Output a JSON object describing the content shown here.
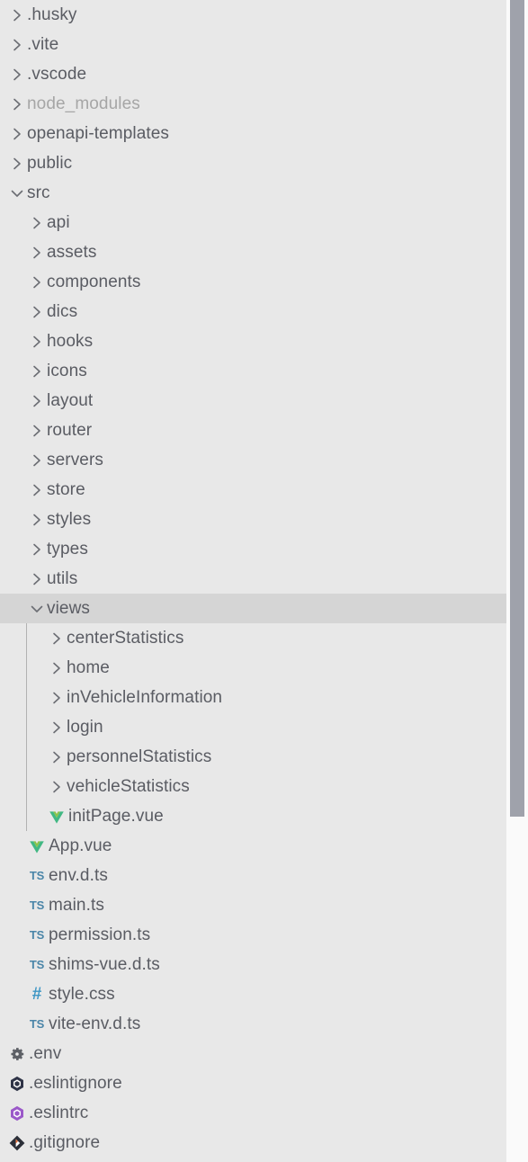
{
  "explorer": {
    "background_color": "#e8e8e8",
    "selected_row_color": "#d5d5d5",
    "label_color": "#5a5c63",
    "dim_label_color": "#a6a6a6",
    "guide_color": "#b2b2b2",
    "scrollbar": {
      "thumb_color": "#9fa2ab",
      "track_color": "#fafafa"
    },
    "rows": [
      {
        "label": ".husky",
        "depth": 0,
        "kind": "folder",
        "state": "collapsed",
        "icon": "chevron-right-icon",
        "dim": false,
        "selected": false
      },
      {
        "label": ".vite",
        "depth": 0,
        "kind": "folder",
        "state": "collapsed",
        "icon": "chevron-right-icon",
        "dim": false,
        "selected": false
      },
      {
        "label": ".vscode",
        "depth": 0,
        "kind": "folder",
        "state": "collapsed",
        "icon": "chevron-right-icon",
        "dim": false,
        "selected": false
      },
      {
        "label": "node_modules",
        "depth": 0,
        "kind": "folder",
        "state": "collapsed",
        "icon": "chevron-right-icon",
        "dim": true,
        "selected": false
      },
      {
        "label": "openapi-templates",
        "depth": 0,
        "kind": "folder",
        "state": "collapsed",
        "icon": "chevron-right-icon",
        "dim": false,
        "selected": false
      },
      {
        "label": "public",
        "depth": 0,
        "kind": "folder",
        "state": "collapsed",
        "icon": "chevron-right-icon",
        "dim": false,
        "selected": false
      },
      {
        "label": "src",
        "depth": 0,
        "kind": "folder",
        "state": "expanded",
        "icon": "chevron-down-icon",
        "dim": false,
        "selected": false
      },
      {
        "label": "api",
        "depth": 1,
        "kind": "folder",
        "state": "collapsed",
        "icon": "chevron-right-icon",
        "dim": false,
        "selected": false
      },
      {
        "label": "assets",
        "depth": 1,
        "kind": "folder",
        "state": "collapsed",
        "icon": "chevron-right-icon",
        "dim": false,
        "selected": false
      },
      {
        "label": "components",
        "depth": 1,
        "kind": "folder",
        "state": "collapsed",
        "icon": "chevron-right-icon",
        "dim": false,
        "selected": false
      },
      {
        "label": "dics",
        "depth": 1,
        "kind": "folder",
        "state": "collapsed",
        "icon": "chevron-right-icon",
        "dim": false,
        "selected": false
      },
      {
        "label": "hooks",
        "depth": 1,
        "kind": "folder",
        "state": "collapsed",
        "icon": "chevron-right-icon",
        "dim": false,
        "selected": false
      },
      {
        "label": "icons",
        "depth": 1,
        "kind": "folder",
        "state": "collapsed",
        "icon": "chevron-right-icon",
        "dim": false,
        "selected": false
      },
      {
        "label": "layout",
        "depth": 1,
        "kind": "folder",
        "state": "collapsed",
        "icon": "chevron-right-icon",
        "dim": false,
        "selected": false
      },
      {
        "label": "router",
        "depth": 1,
        "kind": "folder",
        "state": "collapsed",
        "icon": "chevron-right-icon",
        "dim": false,
        "selected": false
      },
      {
        "label": "servers",
        "depth": 1,
        "kind": "folder",
        "state": "collapsed",
        "icon": "chevron-right-icon",
        "dim": false,
        "selected": false
      },
      {
        "label": "store",
        "depth": 1,
        "kind": "folder",
        "state": "collapsed",
        "icon": "chevron-right-icon",
        "dim": false,
        "selected": false
      },
      {
        "label": "styles",
        "depth": 1,
        "kind": "folder",
        "state": "collapsed",
        "icon": "chevron-right-icon",
        "dim": false,
        "selected": false
      },
      {
        "label": "types",
        "depth": 1,
        "kind": "folder",
        "state": "collapsed",
        "icon": "chevron-right-icon",
        "dim": false,
        "selected": false
      },
      {
        "label": "utils",
        "depth": 1,
        "kind": "folder",
        "state": "collapsed",
        "icon": "chevron-right-icon",
        "dim": false,
        "selected": false
      },
      {
        "label": "views",
        "depth": 1,
        "kind": "folder",
        "state": "expanded",
        "icon": "chevron-down-icon",
        "dim": false,
        "selected": true
      },
      {
        "label": "centerStatistics",
        "depth": 2,
        "kind": "folder",
        "state": "collapsed",
        "icon": "chevron-right-icon",
        "dim": false,
        "selected": false
      },
      {
        "label": "home",
        "depth": 2,
        "kind": "folder",
        "state": "collapsed",
        "icon": "chevron-right-icon",
        "dim": false,
        "selected": false
      },
      {
        "label": "inVehicleInformation",
        "depth": 2,
        "kind": "folder",
        "state": "collapsed",
        "icon": "chevron-right-icon",
        "dim": false,
        "selected": false
      },
      {
        "label": "login",
        "depth": 2,
        "kind": "folder",
        "state": "collapsed",
        "icon": "chevron-right-icon",
        "dim": false,
        "selected": false
      },
      {
        "label": "personnelStatistics",
        "depth": 2,
        "kind": "folder",
        "state": "collapsed",
        "icon": "chevron-right-icon",
        "dim": false,
        "selected": false
      },
      {
        "label": "vehicleStatistics",
        "depth": 2,
        "kind": "folder",
        "state": "collapsed",
        "icon": "chevron-right-icon",
        "dim": false,
        "selected": false
      },
      {
        "label": "initPage.vue",
        "depth": 2,
        "kind": "file",
        "state": "none",
        "icon": "vue-file-icon",
        "dim": false,
        "selected": false
      },
      {
        "label": "App.vue",
        "depth": 1,
        "kind": "file",
        "state": "none",
        "icon": "vue-file-icon",
        "dim": false,
        "selected": false
      },
      {
        "label": "env.d.ts",
        "depth": 1,
        "kind": "file",
        "state": "none",
        "icon": "typescript-file-icon",
        "dim": false,
        "selected": false
      },
      {
        "label": "main.ts",
        "depth": 1,
        "kind": "file",
        "state": "none",
        "icon": "typescript-file-icon",
        "dim": false,
        "selected": false
      },
      {
        "label": "permission.ts",
        "depth": 1,
        "kind": "file",
        "state": "none",
        "icon": "typescript-file-icon",
        "dim": false,
        "selected": false
      },
      {
        "label": "shims-vue.d.ts",
        "depth": 1,
        "kind": "file",
        "state": "none",
        "icon": "typescript-file-icon",
        "dim": false,
        "selected": false
      },
      {
        "label": "style.css",
        "depth": 1,
        "kind": "file",
        "state": "none",
        "icon": "css-file-icon",
        "dim": false,
        "selected": false
      },
      {
        "label": "vite-env.d.ts",
        "depth": 1,
        "kind": "file",
        "state": "none",
        "icon": "typescript-file-icon",
        "dim": false,
        "selected": false
      },
      {
        "label": ".env",
        "depth": 0,
        "kind": "file",
        "state": "none",
        "icon": "gear-config-icon",
        "dim": false,
        "selected": false
      },
      {
        "label": ".eslintignore",
        "depth": 0,
        "kind": "file",
        "state": "none",
        "icon": "eslint-ignore-icon",
        "dim": false,
        "selected": false
      },
      {
        "label": ".eslintrc",
        "depth": 0,
        "kind": "file",
        "state": "none",
        "icon": "eslint-config-icon",
        "dim": false,
        "selected": false
      },
      {
        "label": ".gitignore",
        "depth": 0,
        "kind": "file",
        "state": "none",
        "icon": "git-file-icon",
        "dim": false,
        "selected": false
      }
    ]
  }
}
